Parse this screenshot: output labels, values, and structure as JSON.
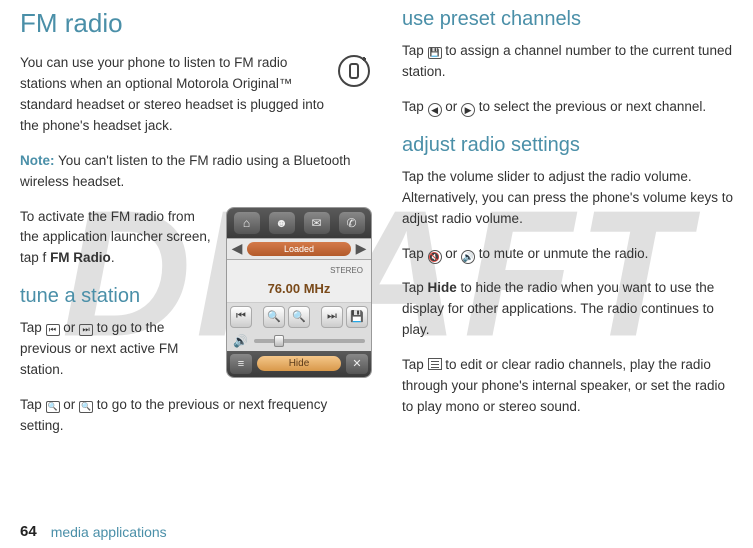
{
  "watermark": "DRAFT",
  "left": {
    "heading_fm_radio": "FM radio",
    "intro_para": "You can use your phone to listen to FM radio stations when an optional Motorola Original™ standard headset or stereo headset is plugged into the phone's headset jack.",
    "note_label": "Note:",
    "note_text": " You can't listen to the FM radio using a Bluetooth wireless headset.",
    "activate_para_1": "To activate the FM radio from the application launcher screen, tap ",
    "activate_icon_f": "f",
    "activate_fm_radio": "FM Radio",
    "activate_period": ".",
    "heading_tune": "tune a station",
    "tune_para_text": " to go to the previous or next active FM station.",
    "tune_prefix": "Tap ",
    "tune_or": " or ",
    "freq_para_text": " to go to the previous or next frequency setting.",
    "freq_prefix": "Tap ",
    "freq_or": " or "
  },
  "radio_ui": {
    "loaded": "Loaded",
    "stereo": "STEREO",
    "frequency": "76.00 MHz",
    "hide": "Hide"
  },
  "right": {
    "heading_preset": "use preset channels",
    "preset_p1_prefix": "Tap ",
    "preset_p1_text": " to assign a channel number to the current tuned station.",
    "preset_p2_prefix": "Tap ",
    "preset_p2_or": " or ",
    "preset_p2_text": " to select the previous or next channel.",
    "heading_adjust": "adjust radio settings",
    "adjust_p1": "Tap the volume slider to adjust the radio volume. Alternatively, you can press the phone's volume keys to adjust radio volume.",
    "adjust_p2_prefix": "Tap ",
    "adjust_p2_or": " or ",
    "adjust_p2_text": " to mute or unmute the radio.",
    "hide_prefix": "Tap ",
    "hide_bold": "Hide",
    "hide_text": " to hide the radio when you want to use the display for other applications. The radio continues to play.",
    "menu_prefix": "Tap ",
    "menu_text": " to edit or clear radio channels, play the radio through your phone's internal speaker, or set the radio to play mono or stereo sound."
  },
  "footer": {
    "page": "64",
    "section": "media applications"
  }
}
